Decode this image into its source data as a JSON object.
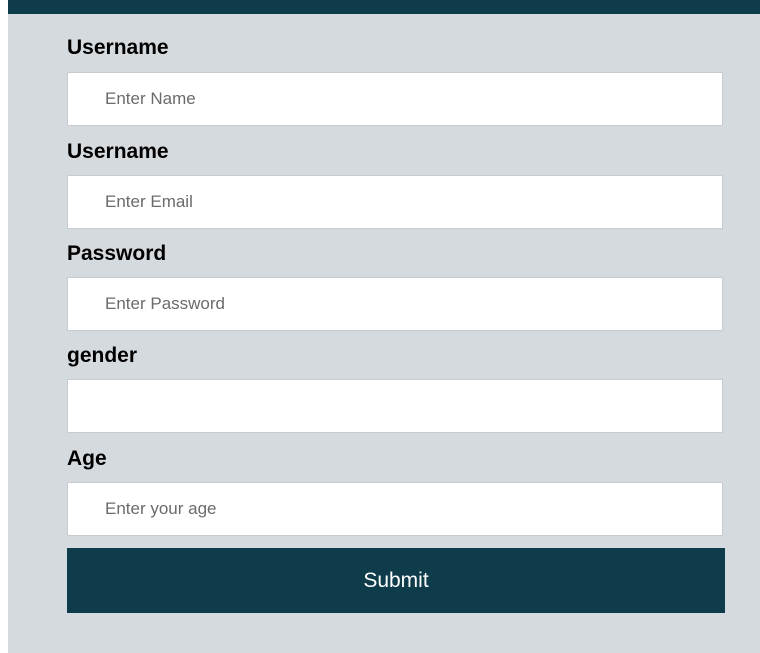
{
  "form": {
    "fields": [
      {
        "label": "Username",
        "placeholder": "Enter Name",
        "value": ""
      },
      {
        "label": "Username",
        "placeholder": "Enter Email",
        "value": ""
      },
      {
        "label": "Password",
        "placeholder": "Enter Password",
        "value": ""
      },
      {
        "label": "gender",
        "placeholder": "",
        "value": ""
      },
      {
        "label": "Age",
        "placeholder": "Enter your age",
        "value": ""
      }
    ],
    "submit_label": "Submit"
  },
  "colors": {
    "header_bar": "#0e3c4b",
    "panel_background": "#d5dadf",
    "button_background": "#0e3c4b",
    "button_text": "#ffffff"
  }
}
